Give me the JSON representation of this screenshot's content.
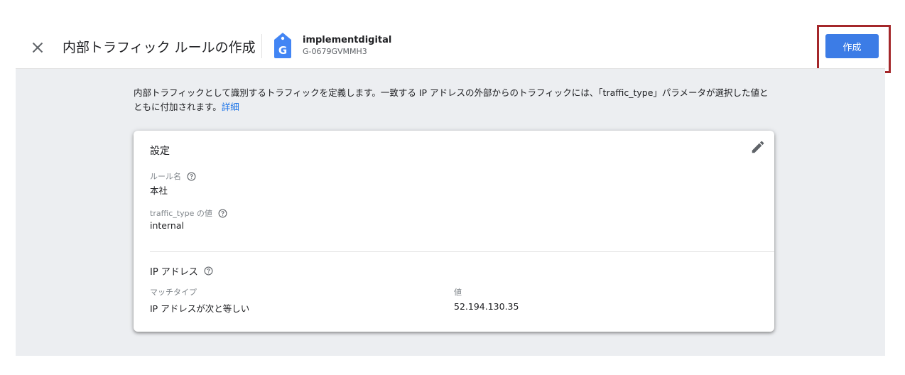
{
  "header": {
    "title": "内部トラフィック ルールの作成",
    "property_name": "implementdigital",
    "property_id": "G-0679GVMMH3",
    "create_label": "作成",
    "tag_icon_letter": "G"
  },
  "description": {
    "text": "内部トラフィックとして識別するトラフィックを定義します。一致する IP アドレスの外部からのトラフィックには、「traffic_type」パラメータが選択した値とともに付加されます。",
    "link": "詳細"
  },
  "settings": {
    "title": "設定",
    "rule_name_label": "ルール名",
    "rule_name_value": "本社",
    "traffic_type_label": "traffic_type の値",
    "traffic_type_value": "internal"
  },
  "ip": {
    "title": "IP アドレス",
    "match_type_label": "マッチタイプ",
    "match_type_value": "IP アドレスが次と等しい",
    "value_label": "値",
    "value": "52.194.130.35"
  },
  "colors": {
    "accent": "#3c7ce6",
    "highlight": "#a4272a",
    "background": "#eceef1"
  }
}
